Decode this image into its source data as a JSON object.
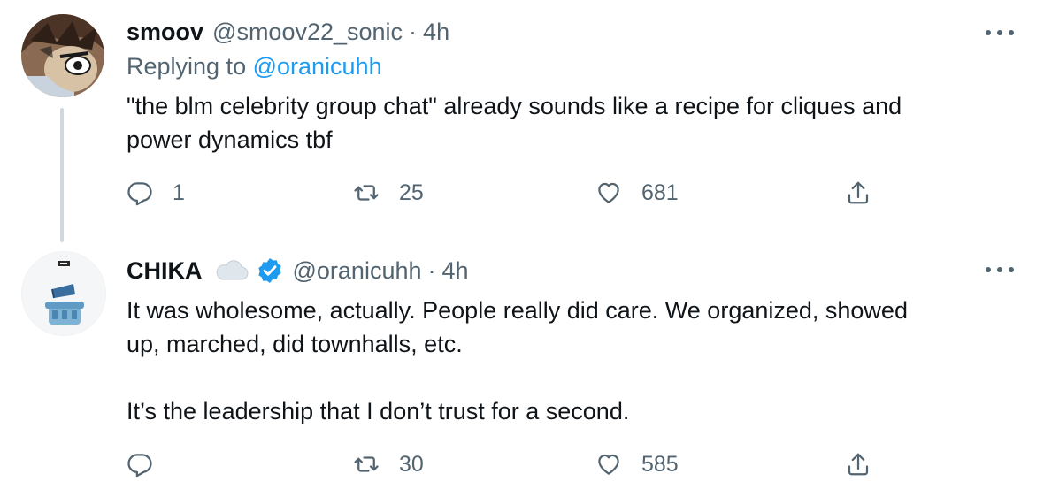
{
  "tweets": [
    {
      "display_name": "smoov",
      "handle": "@smoov22_sonic",
      "separator": "·",
      "time": "4h",
      "replying_prefix": "Replying to ",
      "replying_to": "@oranicuhh",
      "text": "\"the blm celebrity group chat\" already sounds like a recipe for cliques and\npower dynamics tbf",
      "reply_count": "1",
      "retweet_count": "25",
      "like_count": "681"
    },
    {
      "display_name": "CHIKA",
      "handle": "@oranicuhh",
      "separator": "·",
      "time": "4h",
      "verified": true,
      "text": "It was wholesome, actually. People really did care. We organized, showed\nup, marched, did townhalls, etc.\n\nIt’s the leadership that I don’t trust for a second.",
      "reply_count": "",
      "retweet_count": "30",
      "like_count": "585"
    }
  ],
  "icons": {
    "reply": "reply-icon",
    "retweet": "retweet-icon",
    "like": "heart-icon",
    "share": "share-icon",
    "more": "more-icon",
    "verified": "verified-badge-icon",
    "cloud": "cloud-emoji-icon"
  },
  "colors": {
    "text": "#0f1419",
    "secondary": "#536471",
    "link": "#1d9bf0",
    "verified": "#1d9bf0",
    "thread_line": "#cfd9de"
  }
}
